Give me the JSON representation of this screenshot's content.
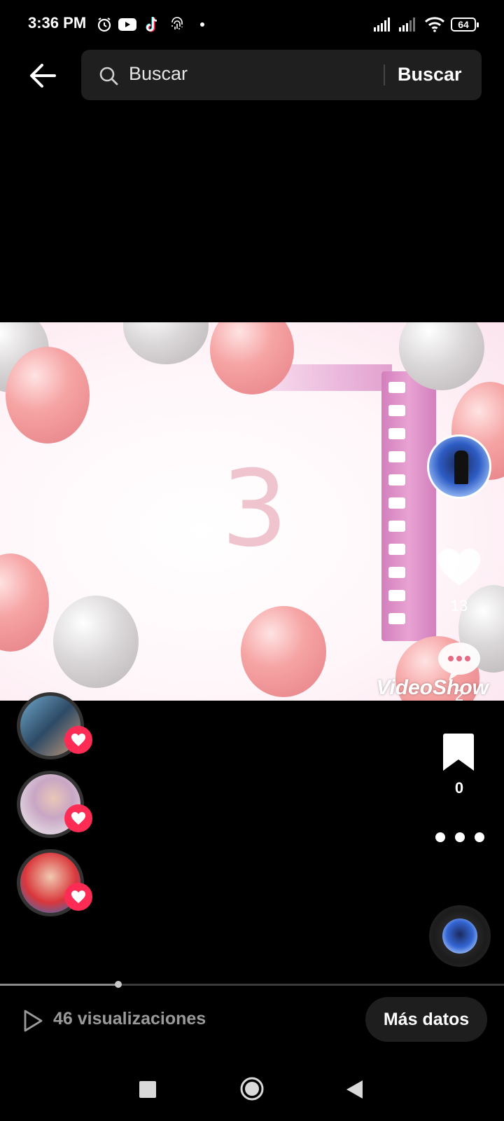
{
  "status_bar": {
    "time": "3:36 PM",
    "icons": [
      "alarm-icon",
      "youtube-icon",
      "tiktok-icon",
      "fingerprint-icon",
      "notification-dot-icon"
    ],
    "right_icons": [
      "signal-icon",
      "signal-icon",
      "wifi-icon",
      "battery-icon"
    ],
    "battery": "64"
  },
  "search": {
    "placeholder": "Buscar",
    "button_label": "Buscar"
  },
  "video": {
    "overlay_number": "3",
    "watermark": "VideoShow"
  },
  "actions": {
    "like_count": "13",
    "comment_count": "2",
    "bookmark_count": "0"
  },
  "likers": [
    "liker-avatar-1",
    "liker-avatar-2",
    "liker-avatar-3"
  ],
  "progress": {
    "fraction": 0.235
  },
  "footer": {
    "views": "46 visualizaciones",
    "more_data_label": "Más datos"
  },
  "colors": {
    "accent_like": "#fe2c55",
    "background": "#000000",
    "search_bg": "#1f1f1f"
  }
}
